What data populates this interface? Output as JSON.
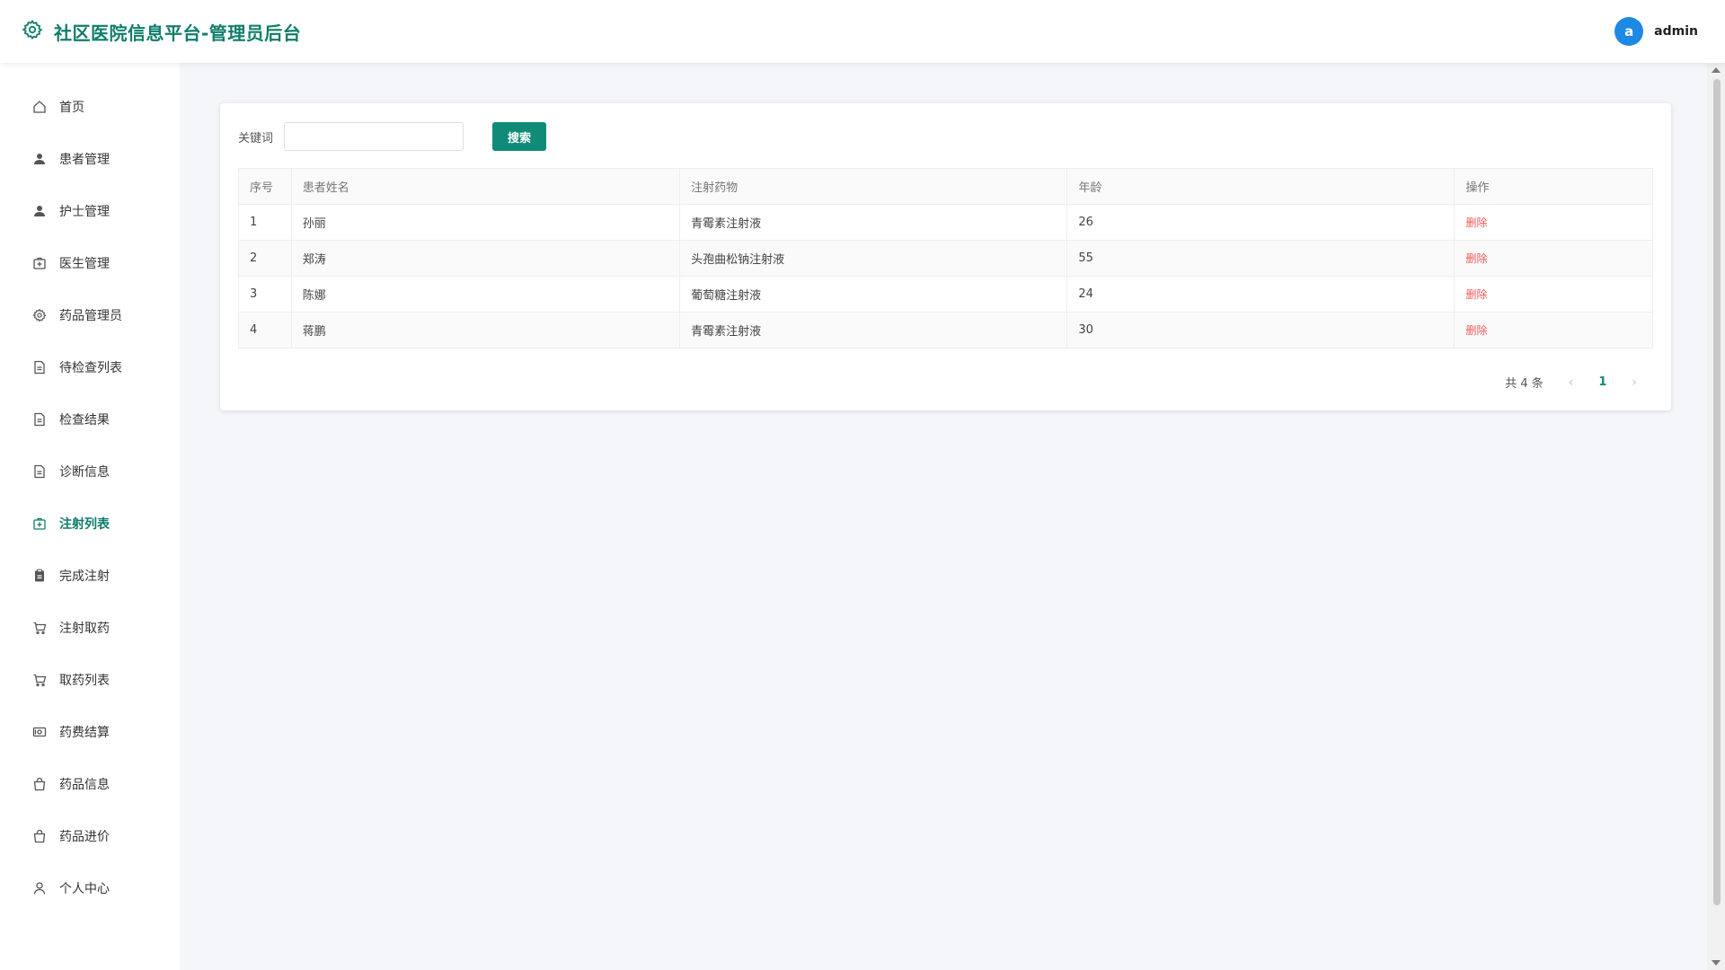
{
  "header": {
    "title": "社区医院信息平台-管理员后台",
    "logo_icon": "gear-icon",
    "avatar_letter": "a",
    "username": "admin",
    "accent_color": "#0f7d6b"
  },
  "sidebar": {
    "items": [
      {
        "label": "首页",
        "icon": "home-icon",
        "active": false
      },
      {
        "label": "患者管理",
        "icon": "user-icon",
        "active": false
      },
      {
        "label": "护士管理",
        "icon": "user-icon",
        "active": false
      },
      {
        "label": "医生管理",
        "icon": "medical-kit-icon",
        "active": false
      },
      {
        "label": "药品管理员",
        "icon": "gear-icon",
        "active": false
      },
      {
        "label": "待检查列表",
        "icon": "document-icon",
        "active": false
      },
      {
        "label": "检查结果",
        "icon": "document-icon",
        "active": false
      },
      {
        "label": "诊断信息",
        "icon": "document-icon",
        "active": false
      },
      {
        "label": "注射列表",
        "icon": "medical-kit-icon",
        "active": true
      },
      {
        "label": "完成注射",
        "icon": "clipboard-icon",
        "active": false
      },
      {
        "label": "注射取药",
        "icon": "cart-icon",
        "active": false
      },
      {
        "label": "取药列表",
        "icon": "cart-icon",
        "active": false
      },
      {
        "label": "药费结算",
        "icon": "money-icon",
        "active": false
      },
      {
        "label": "药品信息",
        "icon": "bag-icon",
        "active": false
      },
      {
        "label": "药品进价",
        "icon": "bag-icon",
        "active": false
      },
      {
        "label": "个人中心",
        "icon": "person-outline-icon",
        "active": false
      }
    ]
  },
  "search": {
    "label": "关键词",
    "value": "",
    "placeholder": "",
    "button_label": "搜索"
  },
  "table": {
    "columns": [
      "序号",
      "患者姓名",
      "注射药物",
      "年龄",
      "操作"
    ],
    "rows": [
      {
        "index": "1",
        "name": "孙丽",
        "drug": "青霉素注射液",
        "age": "26",
        "action": "删除"
      },
      {
        "index": "2",
        "name": "郑涛",
        "drug": "头孢曲松钠注射液",
        "age": "55",
        "action": "删除"
      },
      {
        "index": "3",
        "name": "陈娜",
        "drug": "葡萄糖注射液",
        "age": "24",
        "action": "删除"
      },
      {
        "index": "4",
        "name": "蒋鹏",
        "drug": "青霉素注射液",
        "age": "30",
        "action": "删除"
      }
    ]
  },
  "pagination": {
    "total_label": "共 4 条",
    "prev": "‹",
    "current_page": "1",
    "next": "›"
  }
}
